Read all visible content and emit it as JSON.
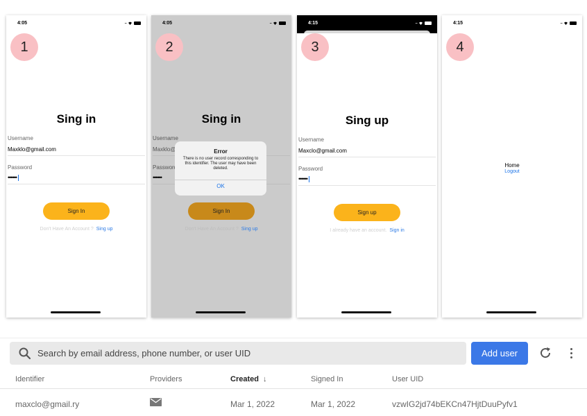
{
  "screens": [
    {
      "time": "4:05",
      "step": "1",
      "title": "Sing in",
      "username_label": "Username",
      "username_value": "Maxklo@gmail.com",
      "password_label": "Password",
      "password_value": "••••••",
      "button_label": "Sign In",
      "alt_text": "Don't Have An Account ?",
      "alt_link": "Sing up"
    },
    {
      "time": "4:05",
      "step": "2",
      "title": "Sing in",
      "username_label": "Username",
      "username_value": "Maxklo@",
      "password_label": "Password",
      "password_value": "••••••",
      "button_label": "Sign In",
      "alt_text": "Don't Have An Account ?",
      "alt_link": "Sing up",
      "alert": {
        "title": "Error",
        "message": "There is no user record corresponding to this identifier. The user may have been deleted.",
        "ok": "OK"
      }
    },
    {
      "time": "4:15",
      "step": "3",
      "title": "Sing up",
      "username_label": "Username",
      "username_value": "Maxclo@gmail.com",
      "password_label": "Password",
      "password_value": "••••••",
      "button_label": "Sign up",
      "alt_text": "I already have an account.",
      "alt_link": "Sign in"
    },
    {
      "time": "4:15",
      "step": "4",
      "home_label": "Home",
      "logout_label": "Logout"
    }
  ],
  "users_panel": {
    "search_placeholder": "Search by email address, phone number, or user UID",
    "add_user_label": "Add user",
    "columns": [
      "Identifier",
      "Providers",
      "Created",
      "Signed In",
      "User UID"
    ],
    "sort_arrow": "↓",
    "rows": [
      {
        "identifier": "maxclo@gmail.ry",
        "provider_icon": "mail-icon",
        "created": "Mar 1, 2022",
        "signed_in": "Mar 1, 2022",
        "uid": "vzwIG2jd74bEKCn47HjtDuuPyfv1"
      }
    ]
  },
  "colors": {
    "badge": "#f9c0c4",
    "primary_button": "#fbb31b",
    "link": "#2d7be5",
    "add_user": "#3b78e7"
  }
}
